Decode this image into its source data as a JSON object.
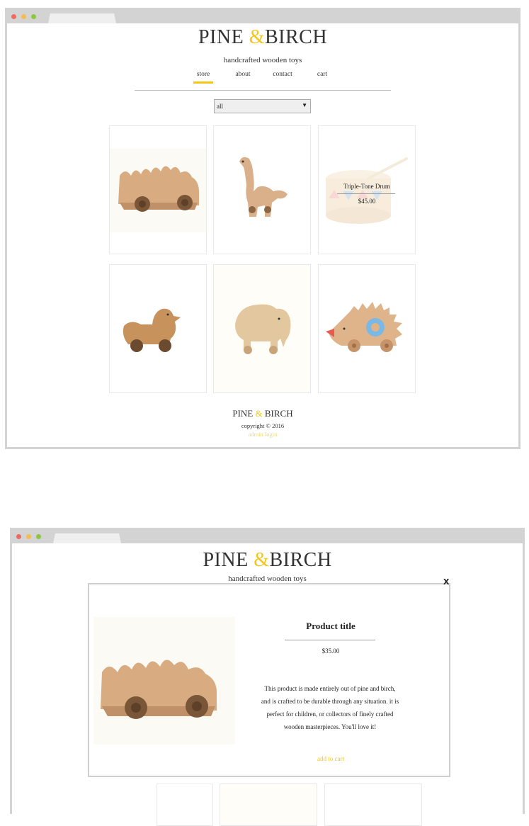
{
  "store": {
    "brand": {
      "name_left": "PINE",
      "amp": "&",
      "name_right": "BIRCH"
    },
    "tagline": "handcrafted wooden toys",
    "nav": [
      {
        "label": "store",
        "active": true
      },
      {
        "label": "about",
        "active": false
      },
      {
        "label": "contact",
        "active": false
      },
      {
        "label": "cart",
        "active": false
      }
    ],
    "filter": {
      "selected": "all"
    },
    "products": [
      {
        "icon": "wooden-car-toy-image"
      },
      {
        "icon": "wooden-dinosaur-toy-image"
      },
      {
        "icon": "wooden-drum-toy-image",
        "hover_title": "Triple-Tone Drum",
        "hover_price": "$45.00"
      },
      {
        "icon": "wooden-duck-toy-image"
      },
      {
        "icon": "wooden-elephant-toy-image"
      },
      {
        "icon": "wooden-hedgehog-toy-image"
      }
    ],
    "footer": {
      "brand": {
        "name_left": "PINE",
        "amp": "&",
        "name_right": "BIRCH"
      },
      "copyright": "copyright © 2016",
      "admin": "admin login"
    }
  },
  "modal_view": {
    "brand": {
      "name_left": "PINE",
      "amp": "&",
      "name_right": "BIRCH"
    },
    "tagline": "handcrafted wooden toys",
    "close_label": "x",
    "product": {
      "title": "Product title",
      "price": "$35.00",
      "description": "This product is made entirely out of pine and birch, and is crafted to be durable through any situation. it is perfect for children, or collectors of finely crafted wooden masterpieces. You'll love it!",
      "add_label": "add to cart"
    }
  },
  "colors": {
    "accent": "#f5c518",
    "frame": "#d3d3d3",
    "text": "#333333"
  }
}
